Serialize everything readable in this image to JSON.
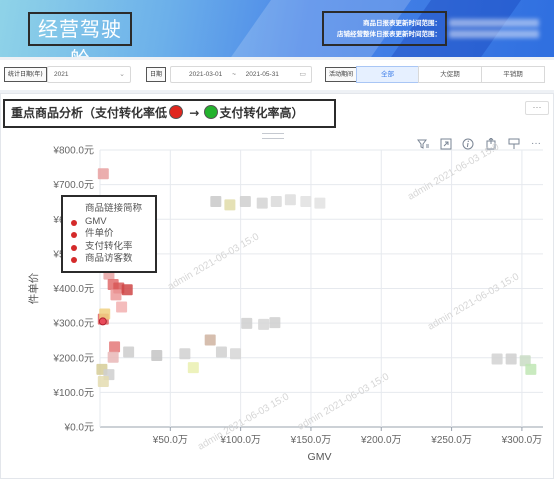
{
  "header": {
    "title": "经营驾驶舱",
    "update_line1": "商品日报表更新时间范围：",
    "update_line2": "店铺经营整体日报表更新时间范围："
  },
  "filters": {
    "stat_date_label": "统计日期(年)",
    "stat_date_value": "2021",
    "date_label": "日期",
    "date_start": "2021-03-01",
    "date_sep": "~",
    "date_end": "2021-05-31",
    "activity_label": "活动期间",
    "segments": [
      "全部",
      "大促期",
      "平销期"
    ],
    "active_segment": "全部"
  },
  "panel": {
    "title_prefix": "重点商品分析（支付转化率低",
    "title_arrow": "→",
    "title_suffix": "支付转化率高）",
    "more_label": "···"
  },
  "toolbar": {
    "icons": [
      "filter-icon",
      "expand-icon",
      "info-icon",
      "export-icon",
      "pin-icon",
      "more-icon"
    ],
    "more_label": "···"
  },
  "legend": {
    "items": [
      "商品链接简称",
      "GMV",
      "件单价",
      "支付转化率",
      "商品访客数"
    ]
  },
  "watermark": {
    "user": "admin",
    "date": "2021-06-03 15:0"
  },
  "chart_data": {
    "type": "scatter",
    "xlabel": "GMV",
    "ylabel": "件单价",
    "xlim": [
      0,
      3150000
    ],
    "ylim": [
      0,
      800
    ],
    "x_ticks": [
      "¥50.0万",
      "¥100.0万",
      "¥150.0万",
      "¥200.0万",
      "¥250.0万",
      "¥300.0万"
    ],
    "x_tick_values": [
      500000,
      1000000,
      1500000,
      2000000,
      2500000,
      3000000
    ],
    "y_ticks": [
      "¥0.0元",
      "¥100.0元",
      "¥200.0元",
      "¥300.0元",
      "¥400.0元",
      "¥500.0元",
      "¥600.0元",
      "¥700.0元",
      "¥800.0元"
    ],
    "y_tick_values": [
      0,
      100,
      200,
      300,
      400,
      500,
      600,
      700,
      800
    ],
    "grid": true,
    "points": [
      {
        "x": 20000,
        "y": 730,
        "color": "#e8a0a0"
      },
      {
        "x": 30000,
        "y": 590,
        "color": "#c9c9c9"
      },
      {
        "x": 40000,
        "y": 560,
        "color": "#d4d4d4"
      },
      {
        "x": 90000,
        "y": 515,
        "color": "#c6c6c6"
      },
      {
        "x": 110000,
        "y": 480,
        "color": "#cfcfcf"
      },
      {
        "x": 60000,
        "y": 440,
        "color": "#e7a3a3"
      },
      {
        "x": 90000,
        "y": 410,
        "color": "#e06b6b"
      },
      {
        "x": 130000,
        "y": 400,
        "color": "#d85858"
      },
      {
        "x": 190000,
        "y": 395,
        "color": "#cf4545"
      },
      {
        "x": 110000,
        "y": 380,
        "color": "#ec9a9a"
      },
      {
        "x": 150000,
        "y": 345,
        "color": "#f2b0b0"
      },
      {
        "x": 20000,
        "y": 310,
        "color": "#e06060"
      },
      {
        "x": 30000,
        "y": 325,
        "color": "#f0d080"
      },
      {
        "x": 100000,
        "y": 230,
        "color": "#e47878"
      },
      {
        "x": 90000,
        "y": 200,
        "color": "#e9b7b7"
      },
      {
        "x": 200000,
        "y": 215,
        "color": "#cccccc"
      },
      {
        "x": 400000,
        "y": 205,
        "color": "#c4c4c4"
      },
      {
        "x": 600000,
        "y": 210,
        "color": "#d0d0d0"
      },
      {
        "x": 780000,
        "y": 250,
        "color": "#cfb3a0"
      },
      {
        "x": 860000,
        "y": 215,
        "color": "#d0d0d0"
      },
      {
        "x": 960000,
        "y": 210,
        "color": "#d6d6d6"
      },
      {
        "x": 1040000,
        "y": 298,
        "color": "#cfcfcf"
      },
      {
        "x": 1160000,
        "y": 295,
        "color": "#d6d6d6"
      },
      {
        "x": 1240000,
        "y": 300,
        "color": "#cfcfcf"
      },
      {
        "x": 10000,
        "y": 165,
        "color": "#d6cc96"
      },
      {
        "x": 60000,
        "y": 150,
        "color": "#cfcfcf"
      },
      {
        "x": 20000,
        "y": 130,
        "color": "#e4dcb0"
      },
      {
        "x": 660000,
        "y": 170,
        "color": "#eaf0b0"
      },
      {
        "x": 820000,
        "y": 650,
        "color": "#c9c9c9"
      },
      {
        "x": 920000,
        "y": 640,
        "color": "#e1dca8"
      },
      {
        "x": 1030000,
        "y": 650,
        "color": "#cfcfcf"
      },
      {
        "x": 1150000,
        "y": 645,
        "color": "#d4d4d4"
      },
      {
        "x": 1250000,
        "y": 650,
        "color": "#d9d9d9"
      },
      {
        "x": 1350000,
        "y": 655,
        "color": "#dddddd"
      },
      {
        "x": 1460000,
        "y": 650,
        "color": "#e0e0e0"
      },
      {
        "x": 1560000,
        "y": 645,
        "color": "#e2e2e2"
      },
      {
        "x": 2820000,
        "y": 195,
        "color": "#d2d2d2"
      },
      {
        "x": 2920000,
        "y": 195,
        "color": "#cfcfcf"
      },
      {
        "x": 3020000,
        "y": 190,
        "color": "#c9dcc4"
      },
      {
        "x": 3060000,
        "y": 165,
        "color": "#bfe6b4"
      }
    ],
    "highlight": {
      "x": 20000,
      "y": 305,
      "color": "#e84a5a"
    }
  }
}
